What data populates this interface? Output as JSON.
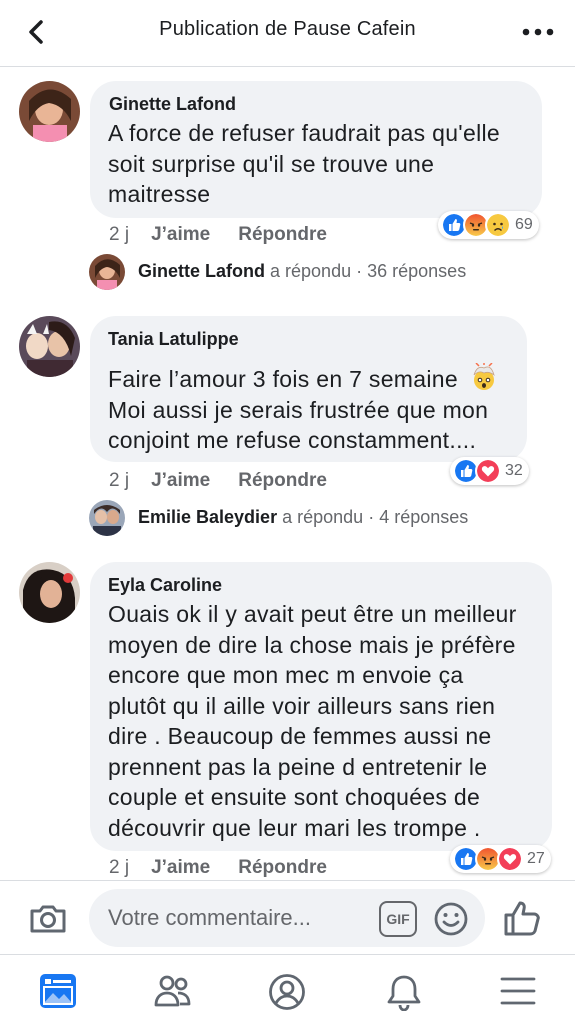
{
  "header": {
    "title": "Publication de Pause Cafein"
  },
  "comments": [
    {
      "author": "Ginette Lafond",
      "lines": [
        "A force de refuser faudrait pas qu'elle",
        "soit surprise qu'il se trouve une",
        "maitresse"
      ],
      "time": "2 j",
      "like": "J’aime",
      "reply": "Répondre",
      "reaction_count": "69",
      "reactions": [
        "like",
        "angry",
        "sad"
      ],
      "reply_summary": {
        "name": "Ginette Lafond",
        "action": "a répondu",
        "sep": "·",
        "count": "36 réponses"
      }
    },
    {
      "author": "Tania Latulippe",
      "lines": [
        "Faire l’amour 3 fois en 7 semaine",
        "Moi aussi je serais frustrée que mon",
        "conjoint me refuse constamment...."
      ],
      "emoji": "exploding-head-icon",
      "time": "2 j",
      "like": "J’aime",
      "reply": "Répondre",
      "reaction_count": "32",
      "reactions": [
        "like",
        "love"
      ],
      "reply_summary": {
        "name": "Emilie Baleydier",
        "action": "a répondu",
        "sep": "·",
        "count": "4 réponses"
      }
    },
    {
      "author": "Eyla Caroline",
      "lines": [
        "Ouais ok il y avait peut être un meilleur",
        "moyen de dire la chose mais je préfère",
        "encore que mon mec m envoie ça",
        "plutôt qu il aille voir ailleurs sans rien",
        "dire . Beaucoup de femmes aussi ne",
        "prennent pas la peine d entretenir le",
        "couple et ensuite sont choquées de",
        "découvrir que leur mari les trompe ."
      ],
      "time": "2 j",
      "like": "J’aime",
      "reply": "Répondre",
      "reaction_count": "27",
      "reactions": [
        "like",
        "angry",
        "love"
      ]
    }
  ],
  "composer": {
    "placeholder": "Votre commentaire...",
    "gif_label": "GIF"
  },
  "colors": {
    "like": "#1877f2",
    "love": "#f33e58",
    "angry": "#f7714b",
    "sad": "#f7b125",
    "accent": "#1877f2"
  }
}
